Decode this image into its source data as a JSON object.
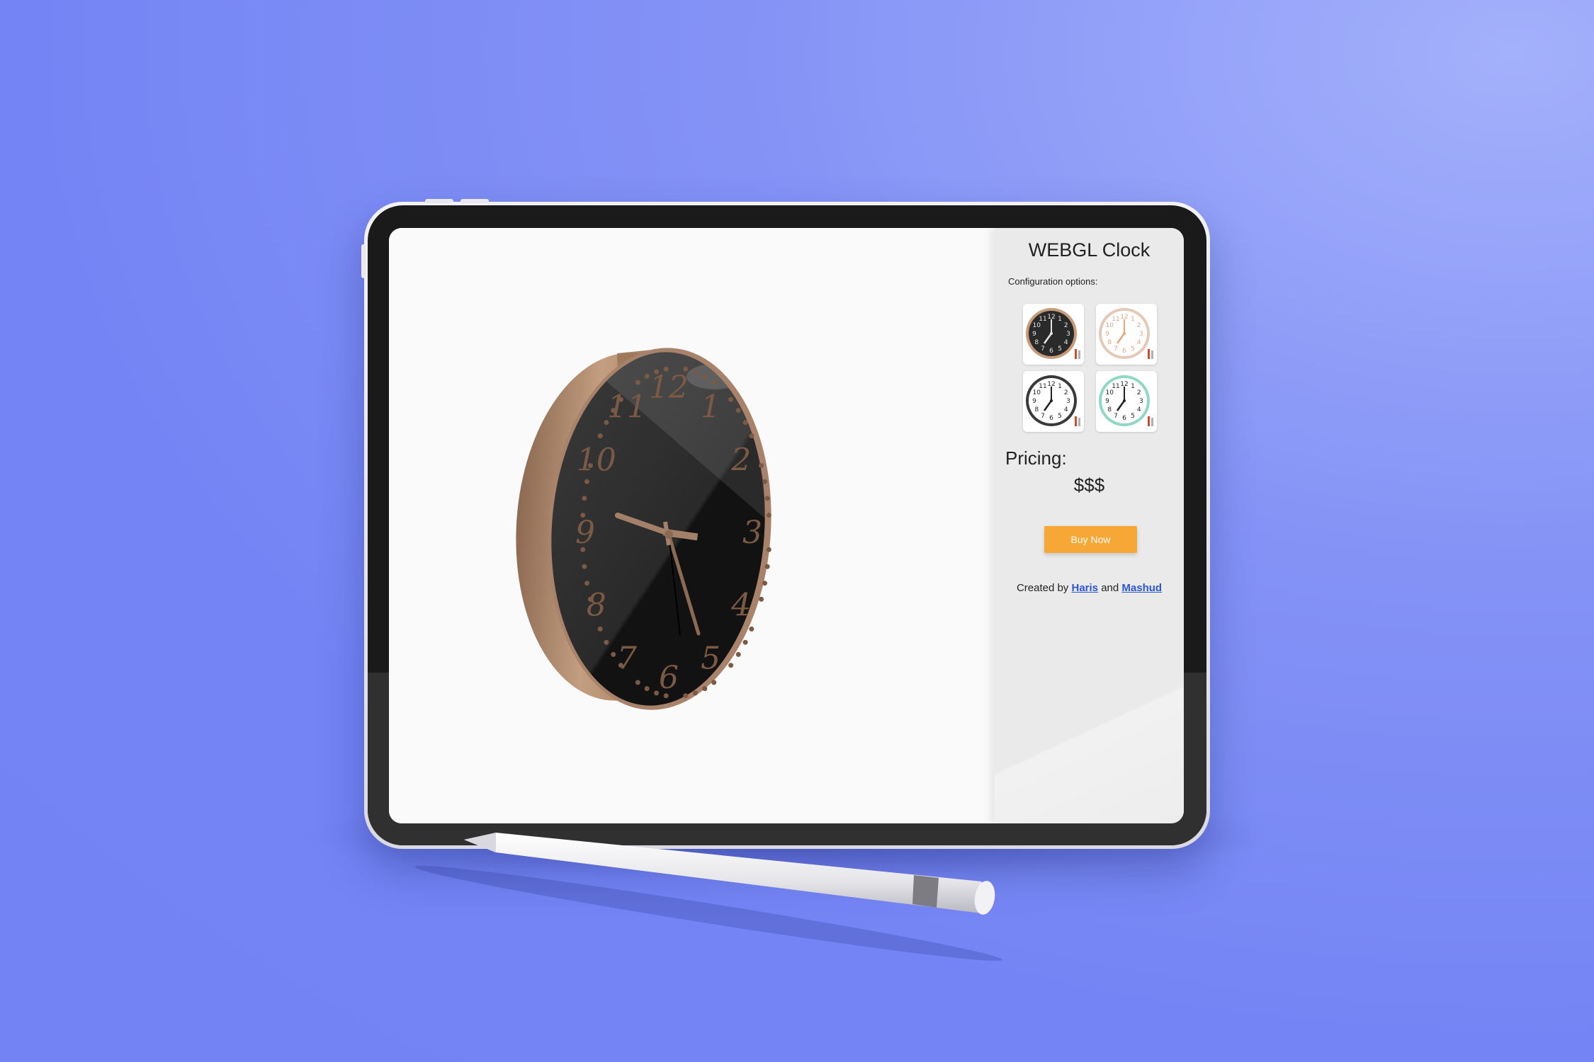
{
  "app": {
    "title": "WEBGL Clock",
    "config_label": "Configuration options:",
    "options": [
      {
        "name": "black-rose-gold",
        "face": "#2a2a2a",
        "rim": "#c79a7a",
        "numerals": "#e6e6e6"
      },
      {
        "name": "white-rose-gold",
        "face": "#ffffff",
        "rim": "#e5c9b8",
        "numerals": "#e5a77c"
      },
      {
        "name": "white-black",
        "face": "#ffffff",
        "rim": "#3a3a3a",
        "numerals": "#222222"
      },
      {
        "name": "white-mint",
        "face": "#ffffff",
        "rim": "#8fd8c6",
        "numerals": "#222222"
      }
    ],
    "pricing_label": "Pricing:",
    "price_value": "$$$",
    "buy_label": "Buy Now",
    "credits": {
      "prefix": "Created by",
      "author1": "Haris",
      "conjunction": "and",
      "author2": "Mashud"
    }
  },
  "clock": {
    "numerals": [
      "12",
      "1",
      "2",
      "3",
      "4",
      "5",
      "6",
      "7",
      "8",
      "9",
      "10",
      "11"
    ],
    "face_color": "#141414",
    "rim_color": "#b08a6a",
    "numeral_color": "#7a5a44"
  },
  "colors": {
    "background": "#7484f4",
    "accent": "#f7a736",
    "link": "#2c55d8"
  }
}
